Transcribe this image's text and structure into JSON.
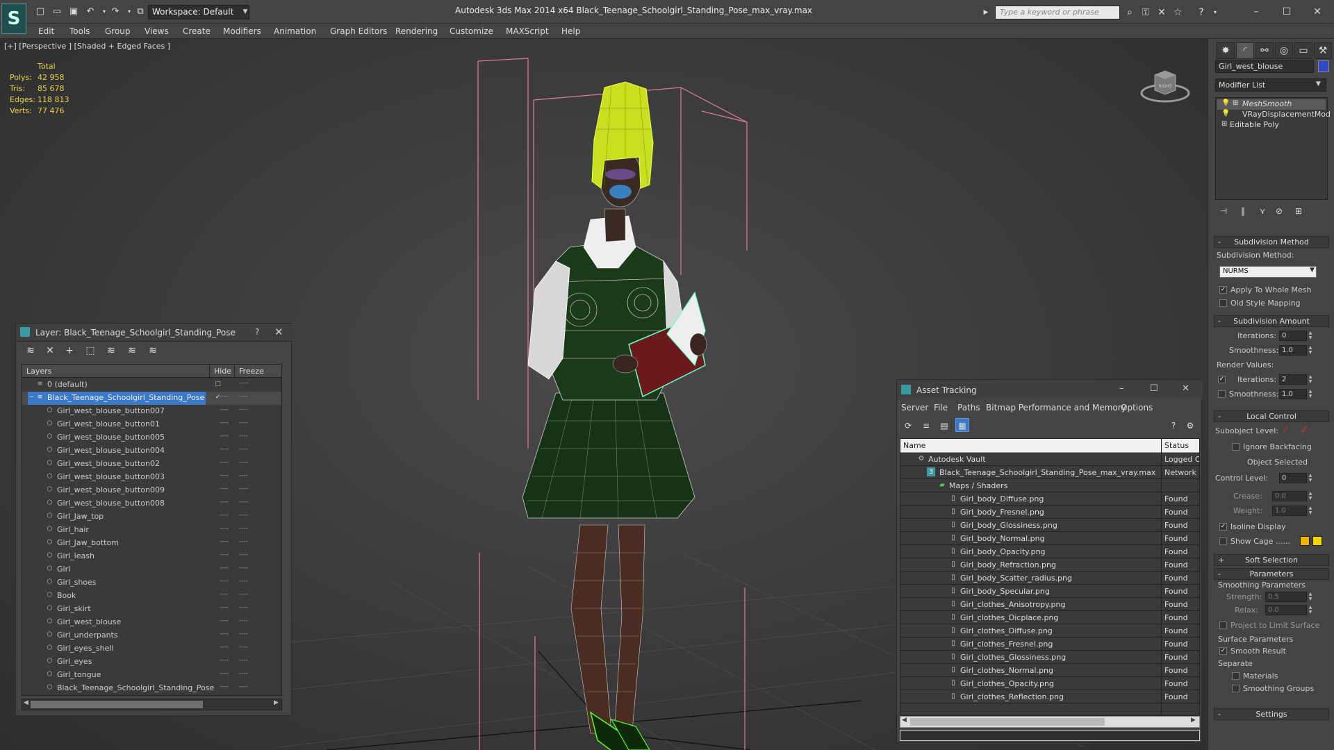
{
  "titlebar": {
    "workspace": "Workspace: Default",
    "app_title": "Autodesk 3ds Max  2014 x64      Black_Teenage_Schoolgirl_Standing_Pose_max_vray.max",
    "search_placeholder": "Type a keyword or phrase"
  },
  "menu": [
    "Edit",
    "Tools",
    "Group",
    "Views",
    "Create",
    "Modifiers",
    "Animation",
    "Graph Editors",
    "Rendering",
    "Customize",
    "MAXScript",
    "Help"
  ],
  "viewport": {
    "label": "[+] [Perspective ] [Shaded + Edged Faces ]",
    "stats_header": "Total",
    "stats": [
      {
        "label": "Polys:",
        "value": "42 958"
      },
      {
        "label": "Tris:",
        "value": "85 678"
      },
      {
        "label": "Edges:",
        "value": "118 813"
      },
      {
        "label": "Verts:",
        "value": "77 476"
      }
    ],
    "viewcube_label": "RIGHT"
  },
  "command_panel": {
    "object_name": "Girl_west_blouse",
    "object_color": "#3048c8",
    "modifier_list": "Modifier List",
    "stack": [
      "MeshSmooth",
      "VRayDisplacementMod",
      "Editable Poly"
    ],
    "subdivision_method_title": "Subdivision Method",
    "subdivision_method_label": "Subdivision Method:",
    "subdivision_method_value": "NURMS",
    "apply_whole_mesh": "Apply To Whole Mesh",
    "old_style_mapping": "Old Style Mapping",
    "subdivision_amount_title": "Subdivision Amount",
    "iterations_label": "Iterations:",
    "iterations_value": "0",
    "smoothness_label": "Smoothness:",
    "smoothness_value": "1.0",
    "render_values": "Render Values:",
    "render_iterations_label": "Iterations:",
    "render_iterations_value": "2",
    "render_smoothness_label": "Smoothness:",
    "render_smoothness_value": "1.0",
    "local_control_title": "Local Control",
    "subobject_level": "Subobject Level:",
    "ignore_backfacing": "Ignore Backfacing",
    "object_selected": "Object Selected",
    "control_level_label": "Control Level:",
    "control_level_value": "0",
    "crease_label": "Crease:",
    "crease_value": "0.0",
    "weight_label": "Weight:",
    "weight_value": "1.0",
    "isoline_display": "Isoline Display",
    "show_cage": "Show Cage ......",
    "cage_color_1": "#f0b400",
    "cage_color_2": "#f0d800",
    "soft_selection_title": "Soft Selection",
    "parameters_title": "Parameters",
    "smoothing_parameters": "Smoothing Parameters",
    "strength_label": "Strength:",
    "strength_value": "0.5",
    "relax_label": "Relax:",
    "relax_value": "0.0",
    "project_limit": "Project to Limit Surface",
    "surface_parameters": "Surface Parameters",
    "smooth_result": "Smooth Result",
    "separate": "Separate",
    "materials": "Materials",
    "smoothing_groups": "Smoothing Groups",
    "settings_title": "Settings"
  },
  "layer_window": {
    "title": "Layer: Black_Teenage_Schoolgirl_Standing_Pose",
    "help": "?",
    "col_layers": "Layers",
    "col_hide": "Hide",
    "col_freeze": "Freeze",
    "rows": [
      "0 (default)",
      "Black_Teenage_Schoolgirl_Standing_Pose",
      "Girl_west_blouse_button007",
      "Girl_west_blouse_button01",
      "Girl_west_blouse_button005",
      "Girl_west_blouse_button004",
      "Girl_west_blouse_button02",
      "Girl_west_blouse_button003",
      "Girl_west_blouse_button009",
      "Girl_west_blouse_button008",
      "Girl_Jaw_top",
      "Girl_hair",
      "Girl_Jaw_bottom",
      "Girl_leash",
      "Girl",
      "Girl_shoes",
      "Book",
      "Girl_skirt",
      "Girl_west_blouse",
      "Girl_underpants",
      "Girl_eyes_shell",
      "Girl_eyes",
      "Girl_tongue",
      "Black_Teenage_Schoolgirl_Standing_Pose"
    ]
  },
  "asset_tracking": {
    "title": "Asset Tracking",
    "menu": [
      "Server",
      "File",
      "Paths",
      "Bitmap Performance and Memory",
      "Options"
    ],
    "col_name": "Name",
    "col_status": "Status",
    "rows": [
      {
        "name": "Autodesk Vault",
        "status": "Logged O"
      },
      {
        "name": "Black_Teenage_Schoolgirl_Standing_Pose_max_vray.max",
        "status": "Network F"
      },
      {
        "name": "Maps / Shaders",
        "status": ""
      },
      {
        "name": "Girl_body_Diffuse.png",
        "status": "Found"
      },
      {
        "name": "Girl_body_Fresnel.png",
        "status": "Found"
      },
      {
        "name": "Girl_body_Glossiness.png",
        "status": "Found"
      },
      {
        "name": "Girl_body_Normal.png",
        "status": "Found"
      },
      {
        "name": "Girl_body_Opacity.png",
        "status": "Found"
      },
      {
        "name": "Girl_body_Refraction.png",
        "status": "Found"
      },
      {
        "name": "Girl_body_Scatter_radius.png",
        "status": "Found"
      },
      {
        "name": "Girl_body_Specular.png",
        "status": "Found"
      },
      {
        "name": "Girl_clothes_Anisotropy.png",
        "status": "Found"
      },
      {
        "name": "Girl_clothes_Dicplace.png",
        "status": "Found"
      },
      {
        "name": "Girl_clothes_Diffuse.png",
        "status": "Found"
      },
      {
        "name": "Girl_clothes_Fresnel.png",
        "status": "Found"
      },
      {
        "name": "Girl_clothes_Glossiness.png",
        "status": "Found"
      },
      {
        "name": "Girl_clothes_Normal.png",
        "status": "Found"
      },
      {
        "name": "Girl_clothes_Opacity.png",
        "status": "Found"
      },
      {
        "name": "Girl_clothes_Reflection.png",
        "status": "Found"
      }
    ]
  }
}
